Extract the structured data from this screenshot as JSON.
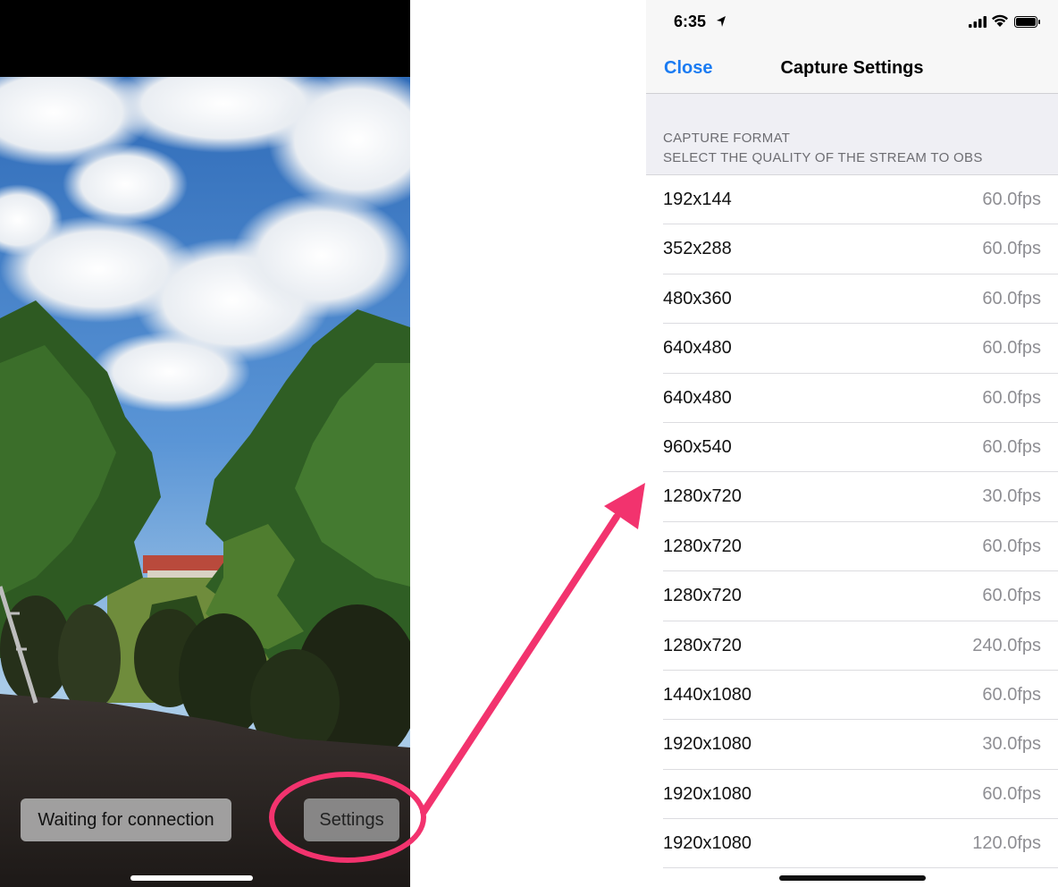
{
  "camera_screen": {
    "status_button_label": "Waiting for connection",
    "settings_button_label": "Settings"
  },
  "settings_screen": {
    "status_bar": {
      "time": "6:35",
      "location_icon": "location-arrow-icon",
      "signal_icon": "cellular-signal-icon",
      "wifi_icon": "wifi-icon",
      "battery_icon": "battery-icon"
    },
    "nav": {
      "close_label": "Close",
      "title": "Capture Settings"
    },
    "section": {
      "title": "CAPTURE FORMAT",
      "subtitle": "SELECT THE QUALITY OF THE STREAM TO OBS"
    },
    "formats": [
      {
        "resolution": "192x144",
        "fps": "60.0fps"
      },
      {
        "resolution": "352x288",
        "fps": "60.0fps"
      },
      {
        "resolution": "480x360",
        "fps": "60.0fps"
      },
      {
        "resolution": "640x480",
        "fps": "60.0fps"
      },
      {
        "resolution": "640x480",
        "fps": "60.0fps"
      },
      {
        "resolution": "960x540",
        "fps": "60.0fps"
      },
      {
        "resolution": "1280x720",
        "fps": "30.0fps"
      },
      {
        "resolution": "1280x720",
        "fps": "60.0fps"
      },
      {
        "resolution": "1280x720",
        "fps": "60.0fps"
      },
      {
        "resolution": "1280x720",
        "fps": "240.0fps"
      },
      {
        "resolution": "1440x1080",
        "fps": "60.0fps"
      },
      {
        "resolution": "1920x1080",
        "fps": "30.0fps"
      },
      {
        "resolution": "1920x1080",
        "fps": "60.0fps"
      },
      {
        "resolution": "1920x1080",
        "fps": "120.0fps"
      }
    ]
  },
  "colors": {
    "ios_blue": "#1a7bf2",
    "annotation_pink": "#f2336e",
    "secondary_gray": "#8e8e93",
    "group_background": "#efeff4"
  }
}
